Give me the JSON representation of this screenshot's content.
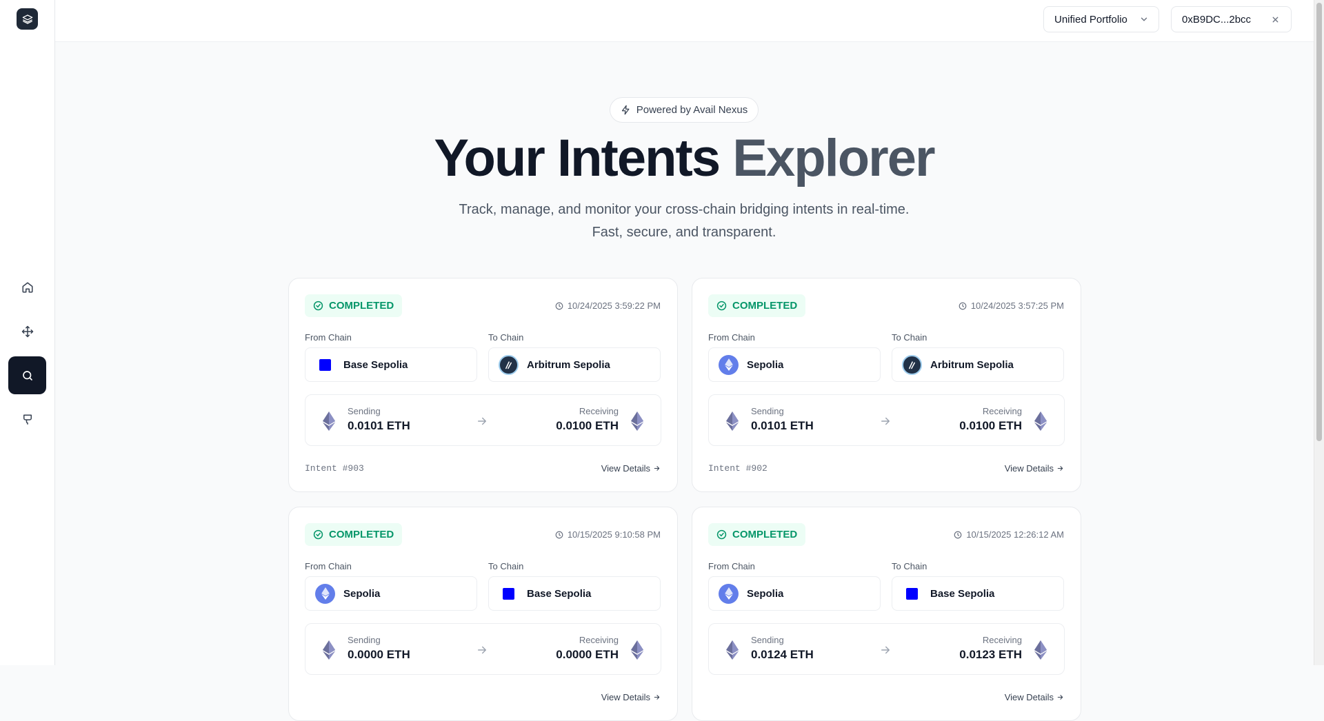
{
  "header": {
    "portfolio_label": "Unified Portfolio",
    "wallet_address": "0xB9DC...2bcc"
  },
  "hero": {
    "badge": "Powered by Avail Nexus",
    "title_main": "Your Intents",
    "title_accent": "Explorer",
    "subtitle": "Track, manage, and monitor your cross-chain bridging intents in real-time. Fast, secure, and transparent."
  },
  "sidebar": {
    "items": [
      {
        "name": "home",
        "icon": "home-icon"
      },
      {
        "name": "bridge",
        "icon": "move-icon"
      },
      {
        "name": "explorer",
        "icon": "search-icon",
        "active": true
      },
      {
        "name": "faucet",
        "icon": "faucet-icon"
      }
    ]
  },
  "labels": {
    "from_chain": "From Chain",
    "to_chain": "To Chain",
    "sending": "Sending",
    "receiving": "Receiving",
    "view_details": "View Details"
  },
  "intents": [
    {
      "status": "COMPLETED",
      "timestamp": "10/24/2025 3:59:22 PM",
      "from_chain": "Base Sepolia",
      "to_chain": "Arbitrum Sepolia",
      "sending": "0.0101 ETH",
      "receiving": "0.0100 ETH",
      "intent_id": "Intent #903"
    },
    {
      "status": "COMPLETED",
      "timestamp": "10/24/2025 3:57:25 PM",
      "from_chain": "Sepolia",
      "to_chain": "Arbitrum Sepolia",
      "sending": "0.0101 ETH",
      "receiving": "0.0100 ETH",
      "intent_id": "Intent #902"
    },
    {
      "status": "COMPLETED",
      "timestamp": "10/15/2025 9:10:58 PM",
      "from_chain": "Sepolia",
      "to_chain": "Base Sepolia",
      "sending": "0.0000 ETH",
      "receiving": "0.0000 ETH",
      "intent_id": ""
    },
    {
      "status": "COMPLETED",
      "timestamp": "10/15/2025 12:26:12 AM",
      "from_chain": "Sepolia",
      "to_chain": "Base Sepolia",
      "sending": "0.0124 ETH",
      "receiving": "0.0123 ETH",
      "intent_id": ""
    }
  ],
  "colors": {
    "status_green": "#059669",
    "status_bg": "#ecfdf5",
    "base_blue": "#0000ff",
    "dark": "#111827"
  }
}
